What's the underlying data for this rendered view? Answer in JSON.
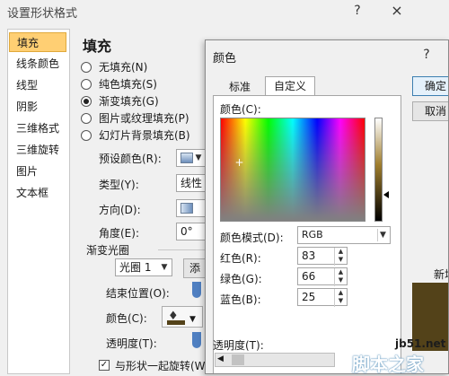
{
  "main_window": {
    "title": "设置形状格式",
    "help": "?",
    "close": "×"
  },
  "sidebar": {
    "items": [
      {
        "label": "填充",
        "selected": true
      },
      {
        "label": "线条颜色"
      },
      {
        "label": "线型"
      },
      {
        "label": "阴影"
      },
      {
        "label": "三维格式"
      },
      {
        "label": "三维旋转"
      },
      {
        "label": "图片"
      },
      {
        "label": "文本框"
      }
    ]
  },
  "fill_panel": {
    "heading": "填充",
    "options": [
      {
        "label": "无填充(N)",
        "checked": false
      },
      {
        "label": "纯色填充(S)",
        "checked": false
      },
      {
        "label": "渐变填充(G)",
        "checked": true
      },
      {
        "label": "图片或纹理填充(P)",
        "checked": false
      },
      {
        "label": "幻灯片背景填充(B)",
        "checked": false
      }
    ],
    "preset_label": "预设颜色(R):",
    "type_label": "类型(Y):",
    "type_value": "线性",
    "direction_label": "方向(D):",
    "angle_label": "角度(E):",
    "angle_value": "0°",
    "stops_label": "渐变光圈",
    "stop_value": "光圈 1",
    "stop_button": "添",
    "end_position_label": "结束位置(O):",
    "color_label": "颜色(C):",
    "transparency_label": "透明度(T):",
    "rotate_label": "与形状一起旋转(W)"
  },
  "color_dialog": {
    "title": "颜色",
    "help": "?",
    "tabs": [
      {
        "label": "标准",
        "active": false
      },
      {
        "label": "自定义",
        "active": true
      }
    ],
    "colors_label": "颜色(C):",
    "model_label": "颜色模式(D):",
    "model_value": "RGB",
    "red_label": "红色(R):",
    "red_value": "83",
    "green_label": "绿色(G):",
    "green_value": "66",
    "blue_label": "蓝色(B):",
    "blue_value": "25",
    "transparency_label": "透明度(T):",
    "ok_button": "确定",
    "cancel_button": "取消",
    "new_label": "新增",
    "new_color": "#534219"
  },
  "watermark": {
    "site": "jb51.net",
    "name": "脚本之家"
  }
}
